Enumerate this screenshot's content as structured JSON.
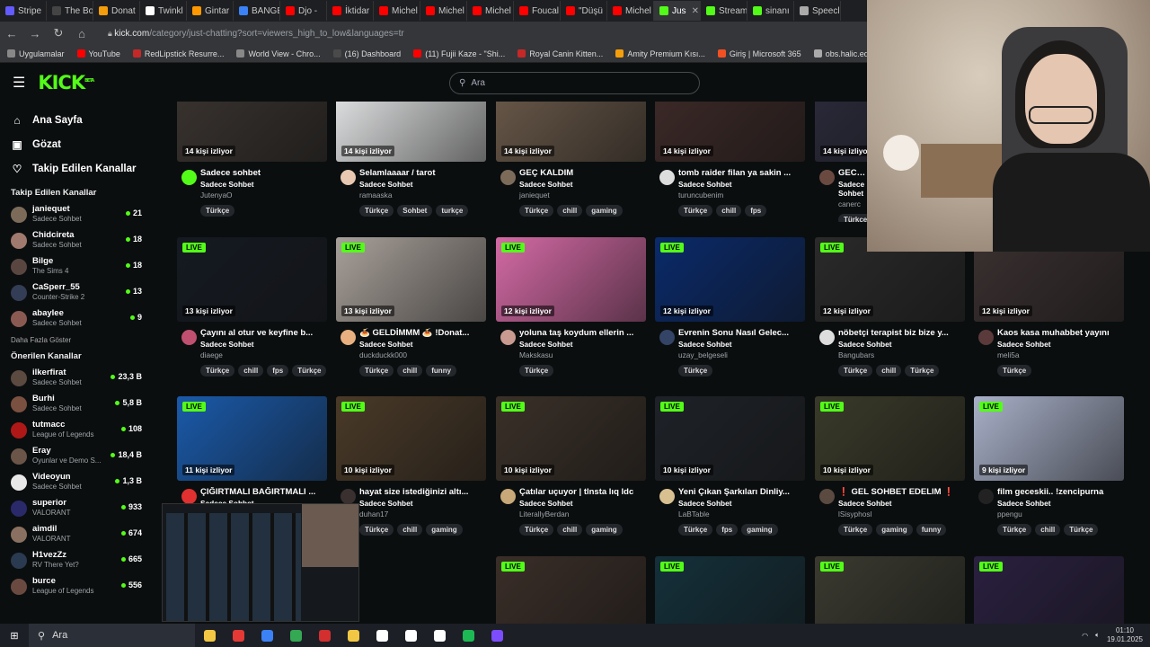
{
  "browser": {
    "tabs": [
      {
        "label": "Stripe",
        "color": "#635bff"
      },
      {
        "label": "The Bo",
        "color": "#444"
      },
      {
        "label": "Donat",
        "color": "#f59e0b"
      },
      {
        "label": "Twinkl",
        "color": "#ffffff"
      },
      {
        "label": "Gintar",
        "color": "#ff9800"
      },
      {
        "label": "BANGE",
        "color": "#3b82f6"
      },
      {
        "label": "Djo -",
        "color": "#ff0000"
      },
      {
        "label": "İktidar",
        "color": "#ff0000"
      },
      {
        "label": "Michel",
        "color": "#ff0000"
      },
      {
        "label": "Michel",
        "color": "#ff0000"
      },
      {
        "label": "Michel",
        "color": "#ff0000"
      },
      {
        "label": "Foucal",
        "color": "#ff0000"
      },
      {
        "label": "\"Düşü",
        "color": "#ff0000"
      },
      {
        "label": "Michel",
        "color": "#ff0000"
      },
      {
        "label": "Jus",
        "color": "#53fc18",
        "active": true
      },
      {
        "label": "Stream",
        "color": "#53fc18"
      },
      {
        "label": "sinanı",
        "color": "#53fc18"
      },
      {
        "label": "Speecl",
        "color": "#aaaaaa"
      }
    ],
    "url_host": "kick.com",
    "url_path": "/category/just-chatting?sort=viewers_high_to_low&languages=tr",
    "bookmarks": [
      {
        "label": "Uygulamalar",
        "color": "#888"
      },
      {
        "label": "YouTube",
        "color": "#ff0000"
      },
      {
        "label": "RedLipstick Resurre...",
        "color": "#c62828"
      },
      {
        "label": "World View - Chro...",
        "color": "#888"
      },
      {
        "label": "(16) Dashboard",
        "color": "#4a4a4a"
      },
      {
        "label": "(11) Fujii Kaze - \"Shi...",
        "color": "#ff0000"
      },
      {
        "label": "Royal Canin Kitten...",
        "color": "#c62828"
      },
      {
        "label": "Amity Premium Kısı...",
        "color": "#f59e0b"
      },
      {
        "label": "Giriş | Microsoft 365",
        "color": "#f25022"
      },
      {
        "label": "obs.halic.edu.tr/ob...",
        "color": "#aaa"
      }
    ]
  },
  "header": {
    "logo": "KICK",
    "search_placeholder": "Ara"
  },
  "sidebar": {
    "nav": [
      {
        "icon": "⌂",
        "label": "Ana Sayfa"
      },
      {
        "icon": "▣",
        "label": "Gözat"
      },
      {
        "icon": "♡",
        "label": "Takip Edilen Kanallar"
      }
    ],
    "followed_title": "Takip Edilen Kanallar",
    "followed": [
      {
        "name": "janiequet",
        "category": "Sadece Sohbet",
        "viewers": "21",
        "color": "#7d6b5a"
      },
      {
        "name": "Chidcireta",
        "category": "Sadece Sohbet",
        "viewers": "18",
        "color": "#a07a6e"
      },
      {
        "name": "Bilge",
        "category": "The Sims 4",
        "viewers": "18",
        "color": "#5a4640"
      },
      {
        "name": "CaSperr_55",
        "category": "Counter-Strike 2",
        "viewers": "13",
        "color": "#333d55"
      },
      {
        "name": "abaylee",
        "category": "Sadece Sohbet",
        "viewers": "9",
        "color": "#8a5a52"
      }
    ],
    "more_label": "Daha Fazla Göster",
    "recommended_title": "Önerilen Kanallar",
    "recommended": [
      {
        "name": "ilkerfirat",
        "category": "Sadece Sohbet",
        "viewers": "23,3 B",
        "color": "#5a4a40"
      },
      {
        "name": "Burhi",
        "category": "Sadece Sohbet",
        "viewers": "5,8 B",
        "color": "#7a5040"
      },
      {
        "name": "tutmacc",
        "category": "League of Legends",
        "viewers": "108",
        "color": "#b01818"
      },
      {
        "name": "Eray",
        "category": "Oyunlar ve Demo S...",
        "viewers": "18,4 B",
        "color": "#6a5548"
      },
      {
        "name": "Videoyun",
        "category": "Sadece Sohbet",
        "viewers": "1,3 B",
        "color": "#e8e8e8"
      },
      {
        "name": "superior",
        "category": "VALORANT",
        "viewers": "933",
        "color": "#2a2a6a"
      },
      {
        "name": "aimdil",
        "category": "VALORANT",
        "viewers": "674",
        "color": "#8a7060"
      },
      {
        "name": "H1vezZz",
        "category": "RV There Yet?",
        "viewers": "665",
        "color": "#2a3a50"
      },
      {
        "name": "burce",
        "category": "League of Legends",
        "viewers": "556",
        "color": "#6a4a40"
      }
    ]
  },
  "streams": [
    {
      "title": "Sadece sohbet",
      "category": "Sadece Sohbet",
      "streamer": "JutenyaO",
      "viewers": "14 kişi izliyor",
      "live": false,
      "tags": [
        "Türkçe"
      ],
      "thumb": "#3a3430",
      "avatar": "#53fc18"
    },
    {
      "title": "Selamlaaaar / tarot",
      "category": "Sadece Sohbet",
      "streamer": "ramaaska",
      "viewers": "14 kişi izliyor",
      "live": false,
      "tags": [
        "Türkçe",
        "Sohbet",
        "turkçe"
      ],
      "thumb": "#e9eaeb",
      "avatar": "#e8c8b0"
    },
    {
      "title": "GEÇ KALDIM",
      "category": "Sadece Sohbet",
      "streamer": "janiequet",
      "viewers": "14 kişi izliyor",
      "live": false,
      "tags": [
        "Türkçe",
        "chill",
        "gaming"
      ],
      "thumb": "#6b5a4a",
      "avatar": "#7d6b5a"
    },
    {
      "title": "tomb raider filan ya sakin ...",
      "category": "Sadece Sohbet",
      "streamer": "turuncubenim",
      "viewers": "14 kişi izliyor",
      "live": false,
      "tags": [
        "Türkçe",
        "chill",
        "fps"
      ],
      "thumb": "#3d2a28",
      "avatar": "#ddd"
    },
    {
      "title": "GECE...",
      "category": "Sadece Sohbet",
      "streamer": "canerc",
      "viewers": "14 kişi izliyor",
      "live": false,
      "tags": [
        "Türkçe"
      ],
      "thumb": "#2a2a3a",
      "avatar": "#6a4a40"
    },
    {
      "title": "Çayını al otur ve keyfine b...",
      "category": "Sadece Sohbet",
      "streamer": "diaege",
      "viewers": "13 kişi izliyor",
      "live": true,
      "tags": [
        "Türkçe",
        "chill",
        "fps",
        "Türkçe"
      ],
      "thumb": "#151a22",
      "avatar": "#c05070"
    },
    {
      "title": "🍝 GELDİMMM 🍝 !Donat...",
      "category": "Sadece Sohbet",
      "streamer": "duckduckk000",
      "viewers": "13 kişi izliyor",
      "live": true,
      "tags": [
        "Türkçe",
        "chill",
        "funny"
      ],
      "thumb": "#a8a09a",
      "avatar": "#e8b080"
    },
    {
      "title": "yoluna taş koydum ellerin ...",
      "category": "Sadece Sohbet",
      "streamer": "Makskasu",
      "viewers": "12 kişi izliyor",
      "live": true,
      "tags": [
        "Türkçe"
      ],
      "thumb": "#d46aa5",
      "avatar": "#c89a90"
    },
    {
      "title": "Evrenin Sonu Nasıl Gelec...",
      "category": "Sadece Sohbet",
      "streamer": "uzay_belgeseli",
      "viewers": "12 kişi izliyor",
      "live": true,
      "tags": [
        "Türkçe"
      ],
      "thumb": "#0a2a6a",
      "avatar": "#334466"
    },
    {
      "title": "nöbetçi terapist biz bize y...",
      "category": "Sadece Sohbet",
      "streamer": "Bangubars",
      "viewers": "12 kişi izliyor",
      "live": true,
      "tags": [
        "Türkçe",
        "chill",
        "Türkçe"
      ],
      "thumb": "#2a2a2a",
      "avatar": "#ddd"
    },
    {
      "title": "Kaos kasa muhabbet yayını",
      "category": "Sadece Sohbet",
      "streamer": "meli5a",
      "viewers": "12 kişi izliyor",
      "live": false,
      "tags": [
        "Türkçe"
      ],
      "thumb": "#3a3030",
      "avatar": "#5a3a3a"
    },
    {
      "title": "ÇIĞIRTMALI BAĞIRTMALI ...",
      "category": "Sadece Sohbet",
      "streamer": "",
      "viewers": "11 kişi izliyor",
      "live": true,
      "tags": [],
      "thumb": "#1a5aaa",
      "avatar": "#e03030"
    },
    {
      "title": "hayat size istediğinizi altı...",
      "category": "Sadece Sohbet",
      "streamer": "duhan17",
      "viewers": "10 kişi izliyor",
      "live": true,
      "tags": [
        "Türkçe",
        "chill",
        "gaming"
      ],
      "thumb": "#4a3a28",
      "avatar": "#3a3030"
    },
    {
      "title": "Çatılar uçuyor | tlnsta lıq ldc",
      "category": "Sadece Sohbet",
      "streamer": "LiterallyBerdan",
      "viewers": "10 kişi izliyor",
      "live": true,
      "tags": [
        "Türkçe",
        "chill",
        "gaming"
      ],
      "thumb": "#3a3028",
      "avatar": "#c8a878"
    },
    {
      "title": "Yeni Çıkan Şarkıları Dinliy...",
      "category": "Sadece Sohbet",
      "streamer": "LaBTable",
      "viewers": "10 kişi izliyor",
      "live": true,
      "tags": [
        "Türkçe",
        "fps",
        "gaming"
      ],
      "thumb": "#1e2228",
      "avatar": "#d8c090"
    },
    {
      "title": "❗ GEL SOHBET EDELIM ❗",
      "category": "Sadece Sohbet",
      "streamer": "lSisyphosl",
      "viewers": "10 kişi izliyor",
      "live": true,
      "tags": [
        "Türkçe",
        "gaming",
        "funny"
      ],
      "thumb": "#3a3a2a",
      "avatar": "#5a4a40"
    },
    {
      "title": "film geceskii.. !zencipurna",
      "category": "Sadece Sohbet",
      "streamer": "ppengu",
      "viewers": "9 kişi izliyor",
      "live": true,
      "tags": [
        "Türkçe",
        "chill",
        "Türkçe"
      ],
      "thumb": "#a8b0c8",
      "avatar": "#222"
    },
    {
      "title": "",
      "category": "",
      "streamer": "",
      "viewers": "",
      "live": true,
      "tags": [],
      "thumb": "#3a2e28",
      "avatar": "#333"
    },
    {
      "title": "",
      "category": "",
      "streamer": "",
      "viewers": "",
      "live": true,
      "tags": [],
      "thumb": "#14303a",
      "avatar": "#333"
    },
    {
      "title": "",
      "category": "",
      "streamer": "",
      "viewers": "",
      "live": true,
      "tags": [],
      "thumb": "#3a3a30",
      "avatar": "#333"
    },
    {
      "title": "",
      "category": "",
      "streamer": "",
      "viewers": "",
      "live": true,
      "tags": [],
      "thumb": "#2a2040",
      "avatar": "#333"
    }
  ],
  "live_label": "LIVE",
  "taskbar": {
    "search_label": "Ara",
    "time": "01:10",
    "date": "19.01.2025",
    "apps": [
      "#f2c744",
      "#e53935",
      "#3b82f6",
      "#34a853",
      "#d32f2f",
      "#f2c744",
      "#ffffff",
      "#ffffff",
      "#ffffff",
      "#1db954",
      "#7c4dff"
    ]
  }
}
